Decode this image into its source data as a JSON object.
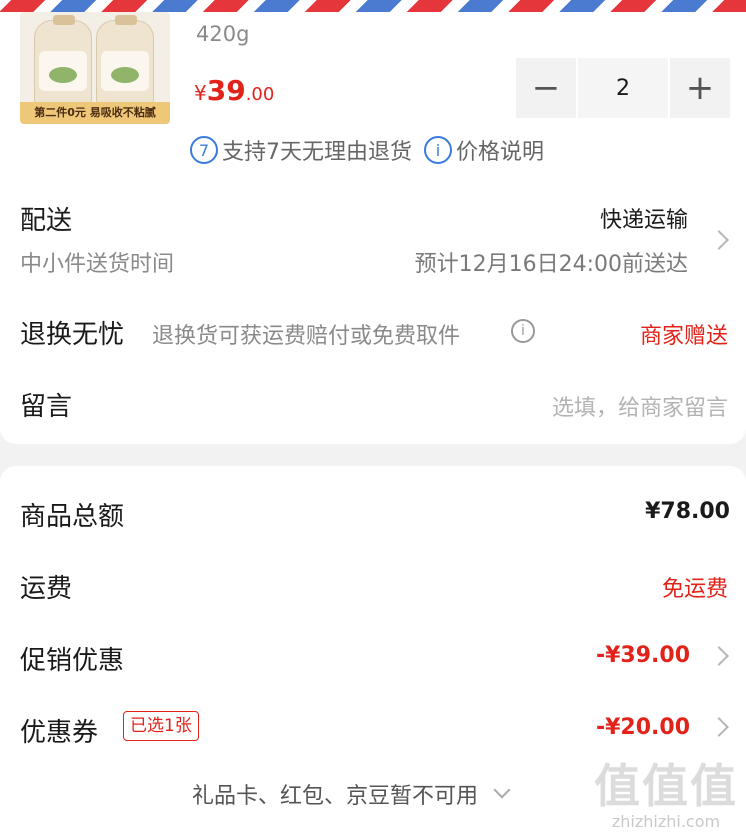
{
  "product": {
    "spec": "420g",
    "price_symbol": "¥",
    "price_int": "39",
    "price_dec": ".00",
    "thumb_banner": "第二件0元  易吸收不粘腻",
    "quantity": "2",
    "minus": "−",
    "plus": "+",
    "service_badge": "7",
    "service_text": "支持7天无理由退货",
    "info_badge": "i",
    "price_note": "价格说明"
  },
  "delivery": {
    "label": "配送",
    "method": "快递运输",
    "sub_label": "中小件送货时间",
    "eta": "预计12月16日24:00前送达"
  },
  "return": {
    "label": "退换无忧",
    "desc": "退换货可获运费赔付或免费取件",
    "info_badge": "i",
    "status": "商家赠送"
  },
  "message": {
    "label": "留言",
    "placeholder": "选填，给商家留言"
  },
  "summary": {
    "goods_total_label": "商品总额",
    "goods_total": "¥78.00",
    "shipping_label": "运费",
    "shipping_value": "免运费",
    "promo_label": "促销优惠",
    "promo_value": "-¥39.00",
    "coupon_label": "优惠券",
    "coupon_tag": "已选1张",
    "coupon_value": "-¥20.00",
    "footer_note": "礼品卡、红包、京豆暂不可用"
  },
  "watermark": {
    "big": "值值值",
    "small": "zhizhizhi.com"
  },
  "colors": {
    "accent_red": "#e2231a",
    "link_blue": "#3b7be0",
    "bg": "#f2f2f2"
  }
}
